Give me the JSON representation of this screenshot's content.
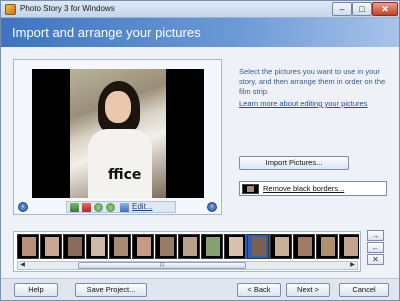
{
  "window": {
    "title": "Photo Story 3 for Windows",
    "min": "–",
    "max": "□",
    "close": "✕"
  },
  "header": {
    "heading": "Import and arrange your pictures"
  },
  "preview": {
    "shirt_text": "ffice",
    "edit_label": "Edit...",
    "prev_icon": "‹",
    "next_icon": "›"
  },
  "instructions": {
    "text": "Select the pictures you want to use in your story, and then arrange them in order on the film strip.",
    "learn_link": "Learn more about editing your pictures"
  },
  "buttons": {
    "import": "Import Pictures...",
    "remove_borders": "Remove black borders...",
    "help": "Help",
    "save_project": "Save Project...",
    "back": "< Back",
    "next": "Next >",
    "cancel": "Cancel"
  },
  "filmstrip": {
    "frames": [
      {
        "color": "#b9907a"
      },
      {
        "color": "#c8a890"
      },
      {
        "color": "#8a6a58"
      },
      {
        "color": "#d0b8a6"
      },
      {
        "color": "#a88a72"
      },
      {
        "color": "#c49a80"
      },
      {
        "color": "#9a7c66"
      },
      {
        "color": "#b8a08a"
      },
      {
        "color": "#86a070"
      },
      {
        "color": "#d6c2ae"
      },
      {
        "color": "#7a6050"
      },
      {
        "color": "#c8b098"
      },
      {
        "color": "#a07a64"
      },
      {
        "color": "#b09070"
      },
      {
        "color": "#c4a48e"
      }
    ],
    "selected_index": 10,
    "scroll_grip": "|||"
  },
  "side_buttons": {
    "move_right": "→",
    "move_left": "←",
    "delete": "✕"
  }
}
